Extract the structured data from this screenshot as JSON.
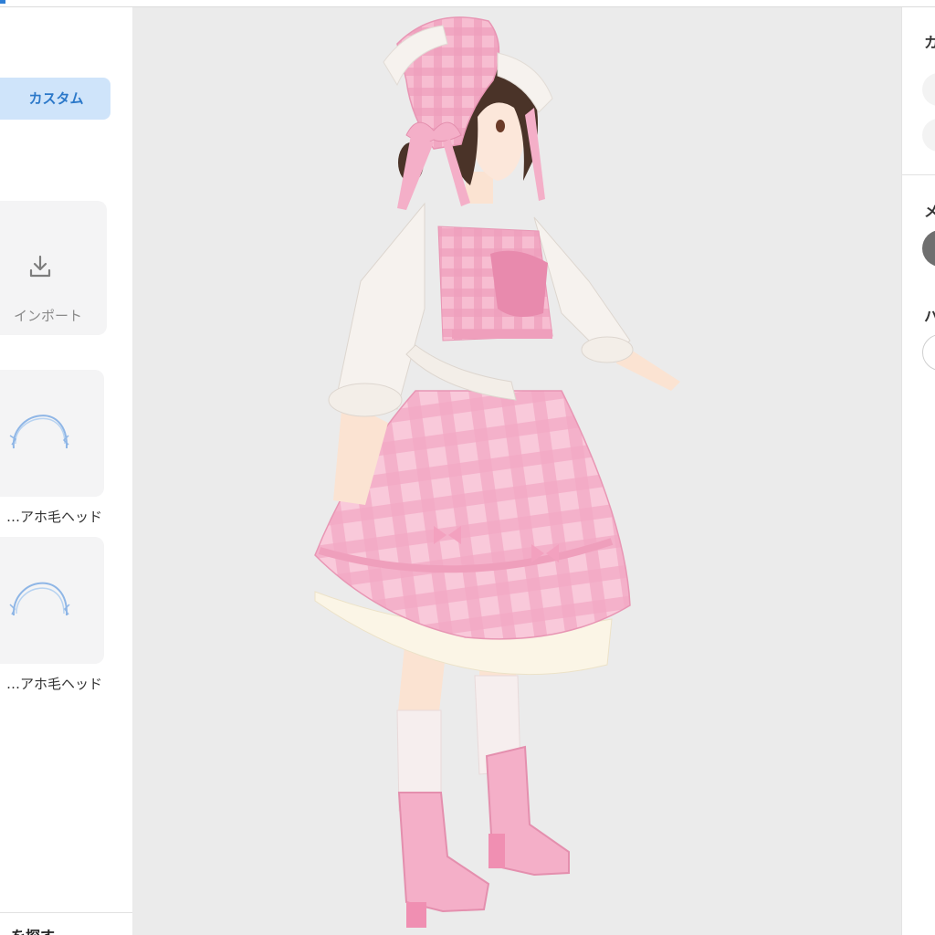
{
  "left_panel": {
    "custom_tab_label": "カスタム",
    "import_label": "インポート",
    "items": [
      {
        "label": "アホ毛ヘッド…",
        "icon": "hair-strand-icon"
      },
      {
        "label": "アホ毛ヘッド…",
        "icon": "hair-strand-icon"
      }
    ],
    "bottom_text": "を探す"
  },
  "right_panel": {
    "heading_1": "カラー",
    "heading_2": "メ",
    "heading_3": "ハ"
  },
  "viewport": {
    "subject": "avatar-3d-model",
    "colors": {
      "background": "#ebebeb",
      "dress": "#f6b9cf",
      "bonnet": "#f4afc8",
      "hair": "#4a3328",
      "blouse": "#f6f2ee",
      "petticoat": "#fbf5e6"
    }
  }
}
